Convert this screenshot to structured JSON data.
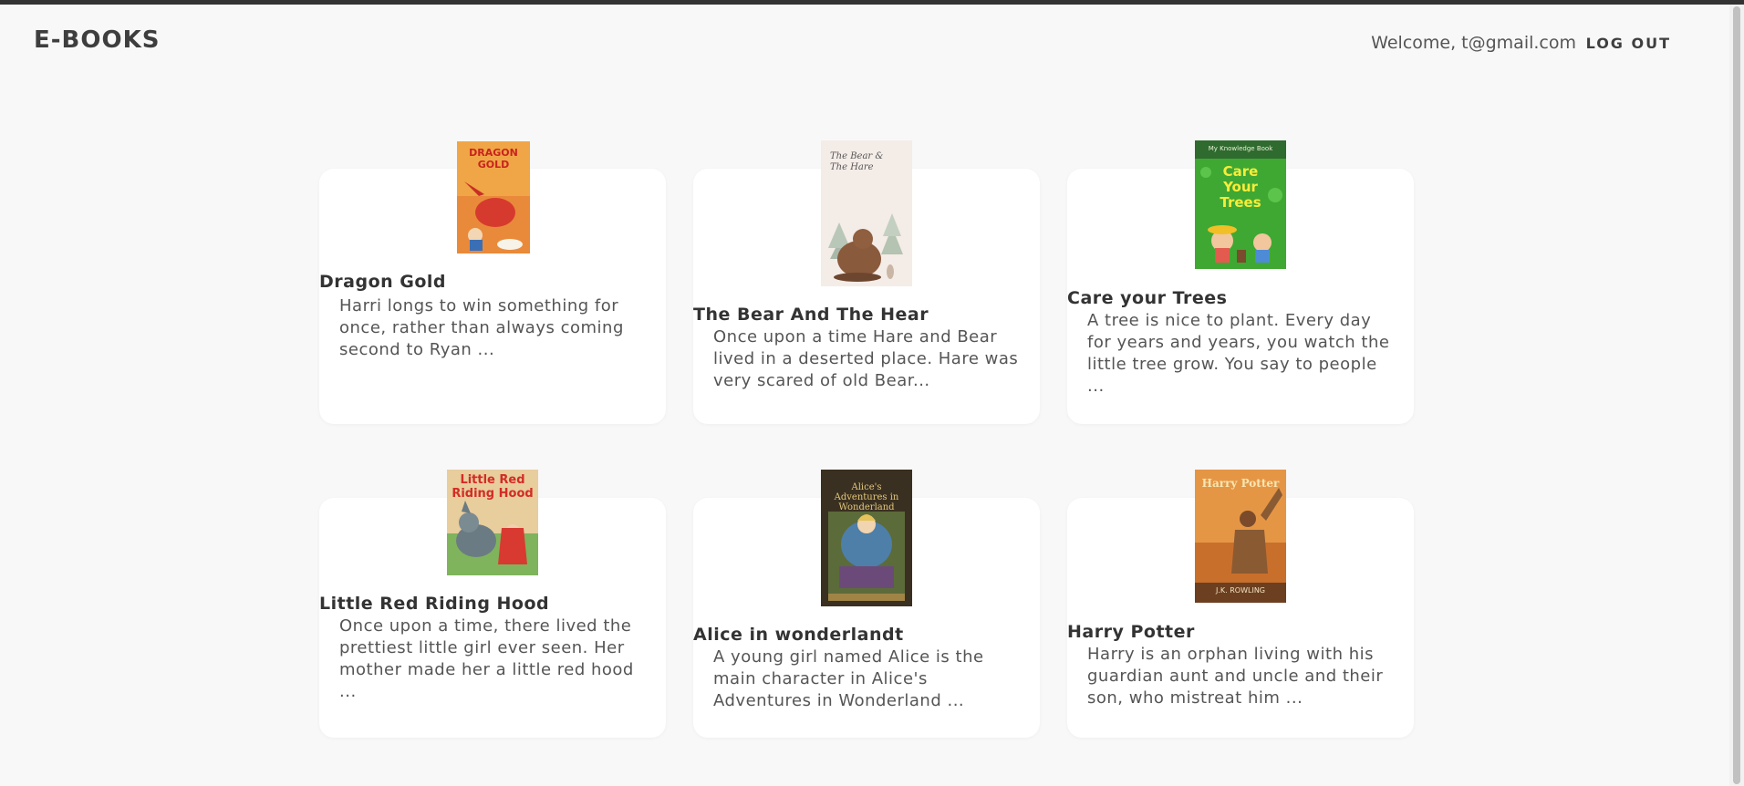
{
  "header": {
    "brand": "E-BOOKS",
    "welcome": "Welcome, t@gmail.com",
    "logout_label": "LOG OUT"
  },
  "books": [
    {
      "title": "Dragon Gold",
      "description": "Harri longs to win something for once, rather than always coming second to Ryan ...",
      "cover_text": "DRAGON GOLD"
    },
    {
      "title": "The Bear And The Hear",
      "description": "Once upon a time Hare and Bear lived in a deserted place. Hare was very scared of old Bear...",
      "cover_text": "The Bear & The Hare"
    },
    {
      "title": "Care your Trees",
      "description": "A tree is nice to plant. Every day for years and years, you watch the little tree grow. You say to people ...",
      "cover_text": "Care Your Trees",
      "cover_subtext": "My Knowledge Book"
    },
    {
      "title": "Little Red Riding Hood",
      "description": "Once upon a time, there lived the prettiest little girl ever seen. Her mother made her a little red hood ...",
      "cover_text": "Little Red Riding Hood"
    },
    {
      "title": "Alice in wonderlandt",
      "description": "A young girl named Alice is the main character in Alice's Adventures in Wonderland ...",
      "cover_text": "Alice's Adventures in Wonderland"
    },
    {
      "title": "Harry Potter",
      "description": "Harry is an orphan living with his guardian aunt and uncle and their son, who mistreat him ...",
      "cover_text": "Harry Potter",
      "cover_subtext": "J.K. ROWLING"
    }
  ],
  "colors": {
    "background": "#f8f8f8",
    "card": "#ffffff",
    "text": "#4a4a4a",
    "topbar": "#333333"
  }
}
